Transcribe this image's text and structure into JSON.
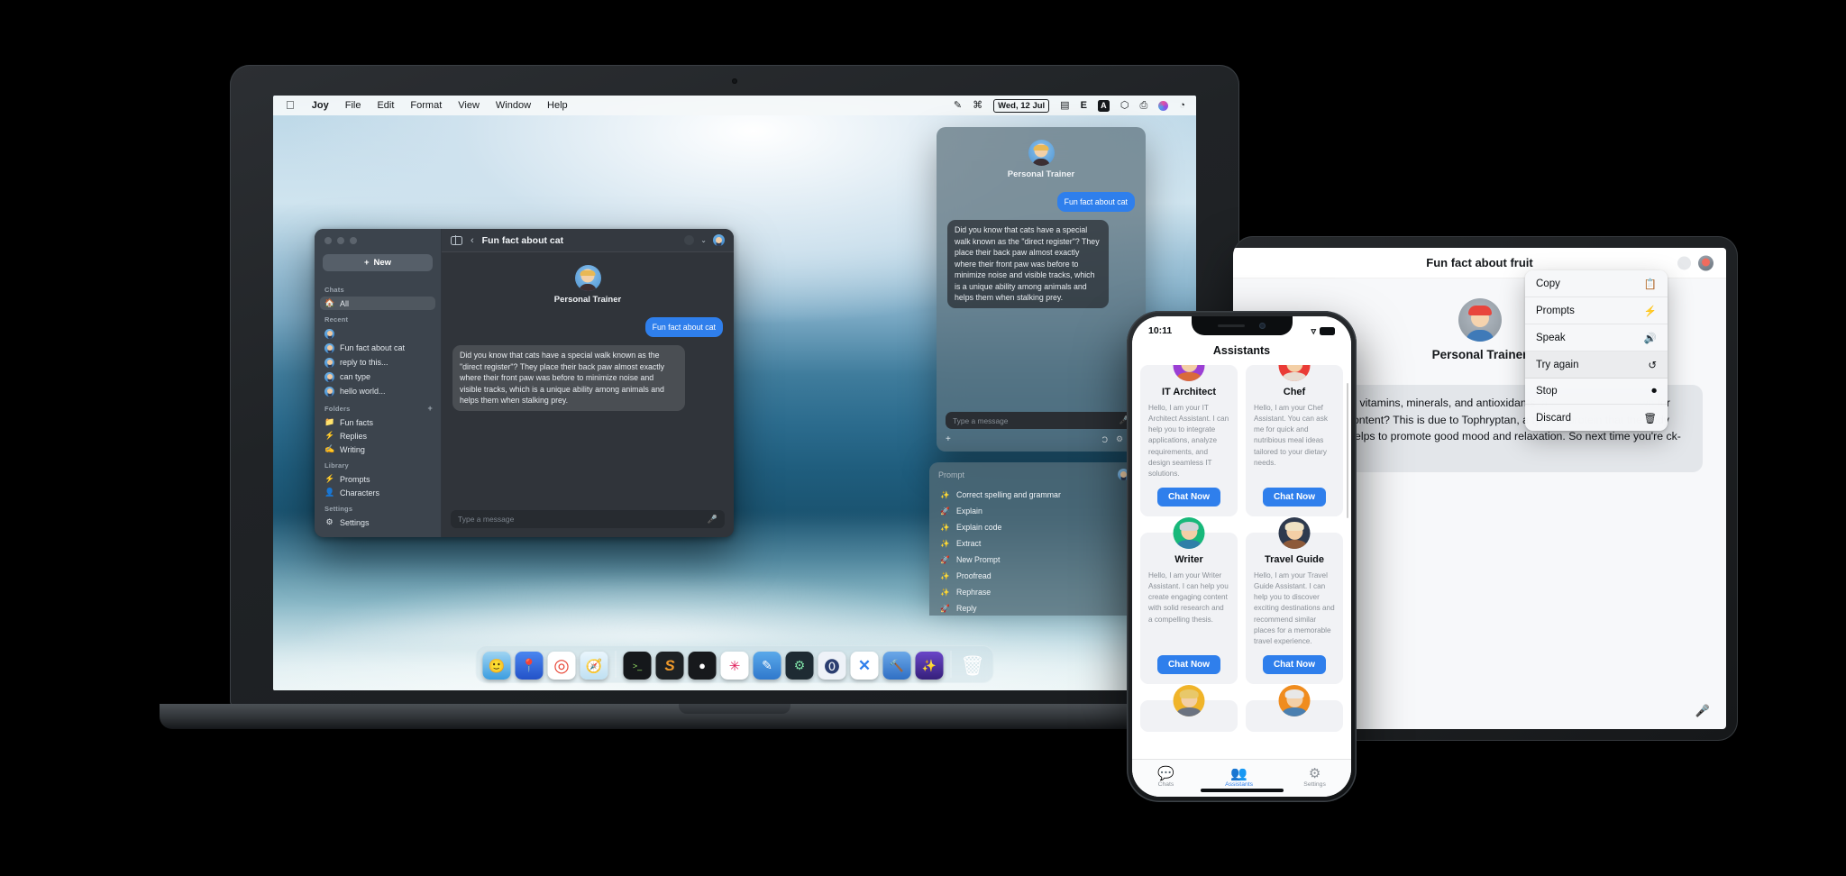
{
  "macos": {
    "menubar": {
      "apple_icon": "apple-logo",
      "items": [
        "Joy",
        "File",
        "Edit",
        "Format",
        "View",
        "Window",
        "Help"
      ],
      "status_items": [
        {
          "name": "pencil-icon",
          "glyph": "✎"
        },
        {
          "name": "bluetooth-icon",
          "glyph": "⌘"
        },
        {
          "name": "date-display",
          "glyph": "Wed, 12 Jul"
        },
        {
          "name": "screen-icon",
          "glyph": "▤"
        },
        {
          "name": "evernote-icon",
          "glyph": "E"
        },
        {
          "name": "keyboard-layout-icon",
          "glyph": "A"
        },
        {
          "name": "dropbox-icon",
          "glyph": "⬡"
        },
        {
          "name": "printer-icon",
          "glyph": "⎙"
        },
        {
          "name": "raycast-icon",
          "glyph": "●"
        },
        {
          "name": "control-center-icon",
          "glyph": "◔"
        }
      ]
    },
    "dock": {
      "apps": [
        {
          "name": "finder",
          "glyph": "🙂",
          "color": "#2b9ae8"
        },
        {
          "name": "maps",
          "glyph": "📍",
          "color": "#2f6fe4"
        },
        {
          "name": "chrome",
          "glyph": "◎",
          "color": "#ffffff"
        },
        {
          "name": "safari",
          "glyph": "🧭",
          "color": "#e9f4fb"
        },
        {
          "name": "terminal",
          "glyph": "■",
          "color": "#1b1f22"
        },
        {
          "name": "sublime-text",
          "glyph": "S",
          "color": "#1f2326"
        },
        {
          "name": "figma",
          "glyph": "◐",
          "color": "#1b1d20"
        },
        {
          "name": "slack",
          "glyph": "✳",
          "color": "#ffffff"
        },
        {
          "name": "notes",
          "glyph": "✎",
          "color": "#3b8de0"
        },
        {
          "name": "cleanmymac",
          "glyph": "⚙",
          "color": "#1d2a33"
        },
        {
          "name": "1password",
          "glyph": "⓿",
          "color": "#e9eef6"
        },
        {
          "name": "vscode",
          "glyph": "✕",
          "color": "#ffffff"
        },
        {
          "name": "xcode",
          "glyph": "🔨",
          "color": "#3f7fd6"
        },
        {
          "name": "joy-app",
          "glyph": "✨",
          "color": "#4a2fa0"
        }
      ],
      "trash": {
        "name": "trash",
        "glyph": "🗑"
      }
    },
    "joy_window": {
      "sidebar": {
        "new_button": {
          "label": "New",
          "icon": "plus-icon"
        },
        "sections": [
          {
            "title": "Chats",
            "items": [
              {
                "label": "All",
                "icon": "🏠",
                "active": true
              }
            ]
          },
          {
            "title": "Recent",
            "items": [
              {
                "label": "",
                "icon": "avatar"
              },
              {
                "label": "Fun fact about cat",
                "icon": "avatar"
              },
              {
                "label": "reply to this...",
                "icon": "avatar"
              },
              {
                "label": "can type",
                "icon": "avatar"
              },
              {
                "label": "hello world...",
                "icon": "avatar"
              }
            ]
          },
          {
            "title": "Folders",
            "add_icon": "+",
            "items": [
              {
                "label": "Fun facts",
                "icon": "📁"
              },
              {
                "label": "Replies",
                "icon": "⚡"
              },
              {
                "label": "Writing",
                "icon": "✍"
              }
            ]
          },
          {
            "title": "Library",
            "items": [
              {
                "label": "Prompts",
                "icon": "⚡"
              },
              {
                "label": "Characters",
                "icon": "👤"
              }
            ]
          },
          {
            "title": "Settings",
            "items": [
              {
                "label": "Settings",
                "icon": "⚙"
              }
            ]
          }
        ]
      },
      "toolbar": {
        "sidebar_toggle_icon": "sidebar-toggle-icon",
        "back_icon": "‹",
        "title": "Fun fact about cat",
        "model_icon": "model-selector-icon",
        "chevron": "⌄",
        "avatar_icon": "persona-avatar"
      },
      "conversation": {
        "persona_name": "Personal Trainer",
        "messages": [
          {
            "role": "user",
            "text": "Fun fact about cat"
          },
          {
            "role": "assistant",
            "text": "Did you know that cats have a special walk known as the \"direct register\"? They place their back paw almost exactly where their front paw was before to minimize noise and visible tracks, which is a unique ability among animals and helps them when stalking prey."
          }
        ]
      },
      "input": {
        "placeholder": "Type a message",
        "mic_icon": "microphone-icon"
      }
    },
    "float_window": {
      "persona_name": "Personal Trainer",
      "messages": [
        {
          "role": "user",
          "text": "Fun fact about cat"
        },
        {
          "role": "assistant",
          "text": "Did you know that cats have a special walk known as the \"direct register\"? They place their back paw almost exactly where their front paw was before to minimize noise and visible tracks, which is a unique ability among animals and helps them when stalking prey."
        }
      ],
      "input": {
        "placeholder": "Type a message",
        "mic_icon": "microphone-icon"
      },
      "tools": {
        "add_icon": "+",
        "format_icon": "Ɔ",
        "settings_icon": "⚙",
        "chevron": "⌄"
      }
    },
    "prompts_panel": {
      "placeholder": "Prompt",
      "avatar_icon": "persona-avatar",
      "items": [
        {
          "label": "Correct spelling and grammar",
          "icon": "✨"
        },
        {
          "label": "Explain",
          "icon": "🚀"
        },
        {
          "label": "Explain code",
          "icon": "✨"
        },
        {
          "label": "Extract",
          "icon": "✨"
        },
        {
          "label": "New Prompt",
          "icon": "🚀"
        },
        {
          "label": "Proofread",
          "icon": "✨"
        },
        {
          "label": "Rephrase",
          "icon": "✨"
        },
        {
          "label": "Reply",
          "icon": "🚀"
        }
      ]
    }
  },
  "ipad": {
    "nav": {
      "title": "Fun fact about fruit",
      "menu_icon": "more-circle-icon",
      "avatar_icon": "persona-avatar"
    },
    "persona_name": "Personal Trainer",
    "message": "l also with various vitamins, minerals, and antioxidants. anas, which are known for their potassium content? This is due to Tophryptan, a type of protein that the body converts, which helps to promote good mood and relaxation. So next time you're ck-me-up you need!",
    "mic_icon": "microphone-icon",
    "context_menu": [
      {
        "label": "Copy",
        "icon": "📋",
        "highlight": false
      },
      {
        "label": "Prompts",
        "icon": "⚡",
        "highlight": false
      },
      {
        "label": "Speak",
        "icon": "🔊",
        "highlight": false
      },
      {
        "label": "Try again",
        "icon": "↺",
        "highlight": true
      },
      {
        "label": "Stop",
        "icon": "⏺",
        "highlight": false
      },
      {
        "label": "Discard",
        "icon": "🗑",
        "highlight": false
      }
    ]
  },
  "iphone": {
    "status": {
      "time": "10:11",
      "wifi_icon": "wifi-icon",
      "battery_icon": "battery-icon"
    },
    "title": "Assistants",
    "assistants": [
      {
        "name": "IT Architect",
        "description": "Hello, I am your IT Architect Assistant. I can help you to integrate applications, analyze requirements, and design seamless IT solutions.",
        "button": "Chat Now",
        "avatar_bg": "#9b3fd4",
        "hair": "#2b1a10",
        "body": "#d96a3a"
      },
      {
        "name": "Chef",
        "description": "Hello, I am your Chef Assistant. You can ask me for quick and nutribious meal ideas tailored to your dietary needs.",
        "button": "Chat Now",
        "avatar_bg": "#ea3b36",
        "hair": "#f4f6f8",
        "body": "#e8dcd0"
      },
      {
        "name": "Writer",
        "description": "Hello, I am your Writer Assistant. I can help you create engaging content with solid research and a compelling thesis.",
        "button": "Chat Now",
        "avatar_bg": "#17b87a",
        "hair": "#cfd4d8",
        "body": "#2f7fa8"
      },
      {
        "name": "Travel Guide",
        "description": "Hello, I am your Travel Guide Assistant. I can help you to discover exciting destinations and recommend similar places for a memorable travel experience.",
        "button": "Chat Now",
        "avatar_bg": "#2e3a4e",
        "hair": "#efe3c4",
        "body": "#8d5a3a"
      },
      {
        "name": "",
        "description": "",
        "button": "",
        "avatar_bg": "#f0b429",
        "hair": "#e8c86a",
        "body": "#6b7280"
      },
      {
        "name": "",
        "description": "",
        "button": "",
        "avatar_bg": "#f08c1e",
        "hair": "#e8e8e8",
        "body": "#4a7fb0"
      }
    ],
    "tabs": [
      {
        "label": "Chats",
        "icon": "💬",
        "active": false
      },
      {
        "label": "Assistants",
        "icon": "👥",
        "active": true
      },
      {
        "label": "Settings",
        "icon": "⚙",
        "active": false
      }
    ]
  }
}
